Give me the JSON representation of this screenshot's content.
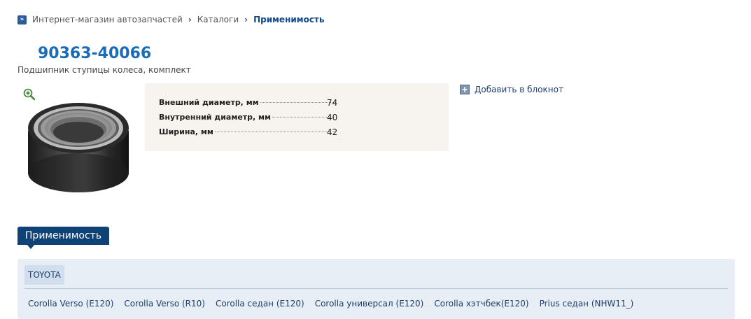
{
  "breadcrumb": {
    "items": [
      {
        "label": "Интернет-магазин автозапчастей"
      },
      {
        "label": "Каталоги"
      }
    ],
    "current": "Применимость"
  },
  "part": {
    "number": "90363-40066",
    "description": "Подшипник ступицы колеса, комплект"
  },
  "specs": [
    {
      "label": "Внешний диаметр, мм",
      "value": "74"
    },
    {
      "label": "Внутренний диаметр, мм",
      "value": "40"
    },
    {
      "label": "Ширина, мм",
      "value": "42"
    }
  ],
  "notebook": {
    "label": "Добавить в блокнот"
  },
  "applicability": {
    "tab_label": "Применимость",
    "brand": "TOYOTA",
    "models": [
      "Corolla Verso (E120)",
      "Corolla Verso (R10)",
      "Corolla седан (E120)",
      "Corolla универсал (E120)",
      "Corolla хэтчбек(E120)",
      "Prius седан (NHW11_)"
    ]
  },
  "colors": {
    "accent": "#1a6bb8",
    "tab_bg": "#0f4276",
    "panel_bg": "#e7eef6",
    "specs_bg": "#f7f3ee"
  }
}
